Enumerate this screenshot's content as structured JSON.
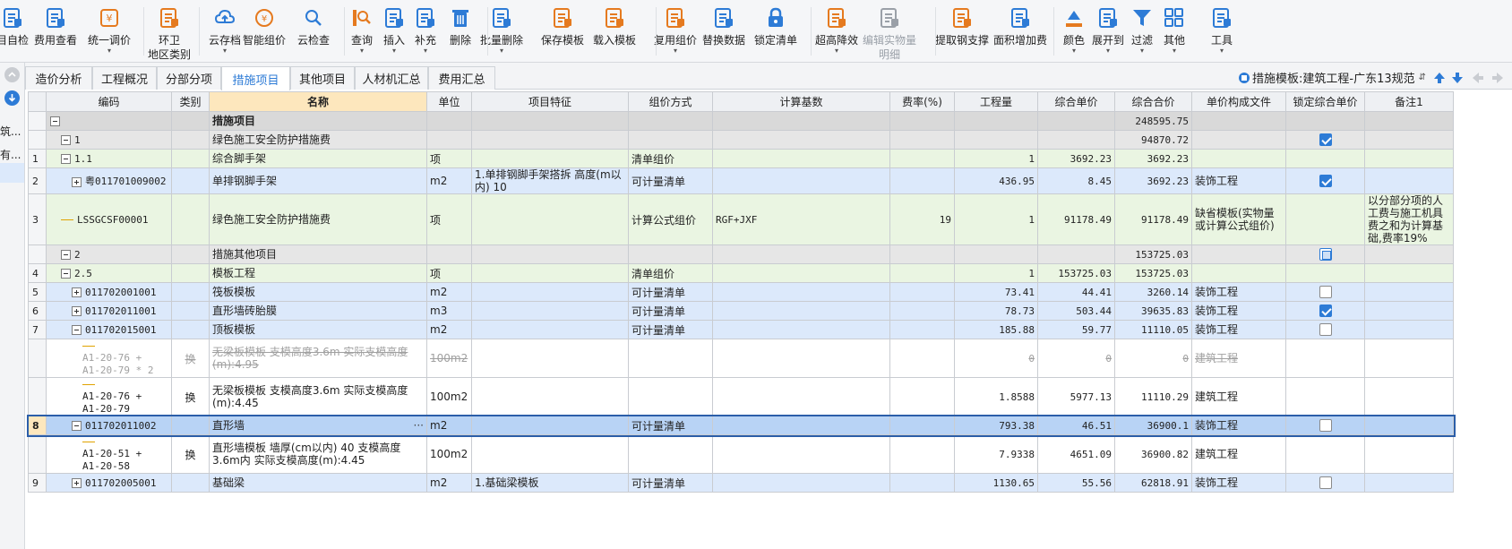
{
  "toolbar": {
    "items": [
      {
        "label": "目自检",
        "icon": "self-check-icon",
        "color": "#2d7bd6"
      },
      {
        "label": "费用查看",
        "icon": "fee-view-icon",
        "color": "#2d7bd6"
      },
      {
        "label": "统一调价",
        "icon": "price-adjust-icon",
        "color": "#e57a1f",
        "caret": true
      },
      {
        "label": "环卫",
        "label2": "地区类别",
        "icon": "region-category-icon",
        "color": "#e57a1f"
      },
      {
        "label": "云存档",
        "icon": "cloud-save-icon",
        "color": "#2d7bd6",
        "caret": true
      },
      {
        "label": "智能组价",
        "icon": "smart-pricing-icon",
        "color": "#e57a1f"
      },
      {
        "label": "云检查",
        "icon": "cloud-check-icon",
        "color": "#2d7bd6"
      },
      {
        "label": "查询",
        "icon": "query-icon",
        "color": "#e57a1f",
        "caret": true
      },
      {
        "label": "插入",
        "icon": "insert-icon",
        "color": "#2d7bd6",
        "caret": true
      },
      {
        "label": "补充",
        "icon": "supplement-icon",
        "color": "#2d7bd6",
        "caret": true
      },
      {
        "label": "删除",
        "icon": "delete-icon",
        "color": "#2d7bd6"
      },
      {
        "label": "批量删除",
        "icon": "batch-delete-icon",
        "color": "#2d7bd6",
        "caret": true
      },
      {
        "label": "保存模板",
        "icon": "save-template-icon",
        "color": "#e57a1f"
      },
      {
        "label": "载入模板",
        "icon": "load-template-icon",
        "color": "#e57a1f"
      },
      {
        "label": "复用组价",
        "icon": "reuse-pricing-icon",
        "color": "#e57a1f",
        "caret": true
      },
      {
        "label": "替换数据",
        "icon": "replace-data-icon",
        "color": "#2d7bd6"
      },
      {
        "label": "锁定清单",
        "icon": "lock-list-icon",
        "color": "#2d7bd6"
      },
      {
        "label": "超高降效",
        "icon": "super-height-icon",
        "color": "#e57a1f",
        "caret": true
      },
      {
        "label": "编辑实物量",
        "label2": "明细",
        "icon": "edit-quantity-icon",
        "color": "#9aa0a8",
        "disabled": true
      },
      {
        "label": "提取钢支撑",
        "icon": "extract-steel-icon",
        "color": "#e57a1f"
      },
      {
        "label": "面积增加费",
        "icon": "area-fee-icon",
        "color": "#2d7bd6"
      },
      {
        "label": "颜色",
        "icon": "color-icon",
        "color": "#2d7bd6",
        "caret": true
      },
      {
        "label": "展开到",
        "icon": "expand-to-icon",
        "color": "#2d7bd6",
        "caret": true
      },
      {
        "label": "过滤",
        "icon": "filter-icon",
        "color": "#2d7bd6",
        "caret": true
      },
      {
        "label": "其他",
        "icon": "other-icon",
        "color": "#2d7bd6",
        "caret": true
      },
      {
        "label": "工具",
        "icon": "tools-icon",
        "color": "#2d7bd6",
        "caret": true
      }
    ]
  },
  "leftstrip": {
    "item1": "筑...",
    "item2": "有..."
  },
  "tabs": [
    {
      "label": "造价分析",
      "active": false
    },
    {
      "label": "工程概况",
      "active": false
    },
    {
      "label": "分部分项",
      "active": false
    },
    {
      "label": "措施项目",
      "active": true
    },
    {
      "label": "其他项目",
      "active": false
    },
    {
      "label": "人材机汇总",
      "active": false
    },
    {
      "label": "费用汇总",
      "active": false
    }
  ],
  "template_info": "措施模板:建筑工程-广东13规范",
  "columns": [
    "编码",
    "类别",
    "名称",
    "单位",
    "项目特征",
    "组价方式",
    "计算基数",
    "费率(%)",
    "工程量",
    "综合单价",
    "综合合价",
    "单价构成文件",
    "锁定综合单价",
    "备注1"
  ],
  "rows": [
    {
      "no": "",
      "style": "bg-gray",
      "tree": "minus",
      "indent": 0,
      "code": "",
      "cat": "",
      "name": "措施项目",
      "unit": "",
      "feature": "",
      "method": "",
      "base": "",
      "rate": "",
      "qty": "",
      "price": "",
      "total": "248595.75",
      "file": "",
      "lock": "none",
      "note": "",
      "bold": true
    },
    {
      "no": "",
      "style": "bg-gray2",
      "tree": "minus",
      "indent": 1,
      "code": "1",
      "cat": "",
      "name": "绿色施工安全防护措施费",
      "unit": "",
      "feature": "",
      "method": "",
      "base": "",
      "rate": "",
      "qty": "",
      "price": "",
      "total": "94870.72",
      "file": "",
      "lock": "on",
      "note": ""
    },
    {
      "no": "1",
      "style": "bg-green",
      "tree": "minus",
      "indent": 1,
      "code": "1.1",
      "cat": "",
      "name": "综合脚手架",
      "unit": "项",
      "feature": "",
      "method": "清单组价",
      "base": "",
      "rate": "",
      "qty": "1",
      "price": "3692.23",
      "total": "3692.23",
      "file": "",
      "lock": "none",
      "note": ""
    },
    {
      "no": "2",
      "style": "bg-blue",
      "tree": "plus",
      "indent": 2,
      "code": "粤011701009002",
      "cat": "",
      "name": "单排钢脚手架",
      "unit": "m2",
      "feature": "1.单排钢脚手架搭拆 高度(m以内) 10",
      "method": "可计量清单",
      "base": "",
      "rate": "",
      "qty": "436.95",
      "price": "8.45",
      "total": "3692.23",
      "file": "装饰工程",
      "lock": "on",
      "note": ""
    },
    {
      "no": "3",
      "style": "bg-green",
      "tree": "line",
      "indent": 1,
      "code": "LSSGCSF00001",
      "cat": "",
      "name": "绿色施工安全防护措施费",
      "unit": "项",
      "feature": "",
      "method": "计算公式组价",
      "base": "RGF+JXF",
      "rate": "19",
      "qty": "1",
      "price": "91178.49",
      "total": "91178.49",
      "file": "缺省模板(实物量或计算公式组价)",
      "lock": "none",
      "note": "以分部分项的人工费与施工机具费之和为计算基础,费率19%",
      "tall": true
    },
    {
      "no": "",
      "style": "bg-gray2",
      "tree": "minus",
      "indent": 1,
      "code": "2",
      "cat": "",
      "name": "措施其他项目",
      "unit": "",
      "feature": "",
      "method": "",
      "base": "",
      "rate": "",
      "qty": "",
      "price": "",
      "total": "153725.03",
      "file": "",
      "lock": "mixed",
      "note": ""
    },
    {
      "no": "4",
      "style": "bg-green",
      "tree": "minus",
      "indent": 1,
      "code": "2.5",
      "cat": "",
      "name": "模板工程",
      "unit": "项",
      "feature": "",
      "method": "清单组价",
      "base": "",
      "rate": "",
      "qty": "1",
      "price": "153725.03",
      "total": "153725.03",
      "file": "",
      "lock": "none",
      "note": ""
    },
    {
      "no": "5",
      "style": "bg-blue",
      "tree": "plus",
      "indent": 2,
      "code": "011702001001",
      "cat": "",
      "name": "筏板模板",
      "unit": "m2",
      "feature": "",
      "method": "可计量清单",
      "base": "",
      "rate": "",
      "qty": "73.41",
      "price": "44.41",
      "total": "3260.14",
      "file": "装饰工程",
      "lock": "off",
      "note": ""
    },
    {
      "no": "6",
      "style": "bg-blue",
      "tree": "plus",
      "indent": 2,
      "code": "011702011001",
      "cat": "",
      "name": "直形墙砖胎膜",
      "unit": "m3",
      "feature": "",
      "method": "可计量清单",
      "base": "",
      "rate": "",
      "qty": "78.73",
      "price": "503.44",
      "total": "39635.83",
      "file": "装饰工程",
      "lock": "on",
      "note": ""
    },
    {
      "no": "7",
      "style": "bg-blue",
      "tree": "minus",
      "indent": 2,
      "code": "011702015001",
      "cat": "",
      "name": "顶板模板",
      "unit": "m2",
      "feature": "",
      "method": "可计量清单",
      "base": "",
      "rate": "",
      "qty": "185.88",
      "price": "59.77",
      "total": "11110.05",
      "file": "装饰工程",
      "lock": "off",
      "note": ""
    },
    {
      "no": "",
      "style": "bg-white strike",
      "tree": "sub",
      "indent": 3,
      "code": "A1-20-76 + A1-20-79 * 2",
      "cat": "换",
      "name": "无梁板模板 支模高度3.6m 实际支模高度(m):4.95",
      "unit": "100m2",
      "feature": "",
      "method": "",
      "base": "",
      "rate": "",
      "qty": "0",
      "price": "0",
      "total": "0",
      "file": "建筑工程",
      "lock": "none",
      "note": "",
      "tall": true
    },
    {
      "no": "",
      "style": "bg-white",
      "tree": "sub",
      "indent": 3,
      "code": "A1-20-76 + A1-20-79",
      "cat": "换",
      "name": "无梁板模板 支模高度3.6m 实际支模高度(m):4.45",
      "unit": "100m2",
      "feature": "",
      "method": "",
      "base": "",
      "rate": "",
      "qty": "1.8588",
      "price": "5977.13",
      "total": "11110.29",
      "file": "建筑工程",
      "lock": "none",
      "note": "",
      "tall": true
    },
    {
      "no": "8",
      "style": "bg-sel",
      "tree": "minus",
      "indent": 2,
      "code": "011702011002",
      "cat": "",
      "name": "直形墙",
      "unit": "m2",
      "feature": "",
      "method": "可计量清单",
      "base": "",
      "rate": "",
      "qty": "793.38",
      "price": "46.51",
      "total": "36900.1",
      "file": "装饰工程",
      "lock": "off",
      "note": "",
      "ellipsis": "···"
    },
    {
      "no": "",
      "style": "bg-white",
      "tree": "sub",
      "indent": 3,
      "code": "A1-20-51 + A1-20-58",
      "cat": "换",
      "name": "直形墙模板 墙厚(cm以内) 40 支模高度3.6m内 实际支模高度(m):4.45",
      "unit": "100m2",
      "feature": "",
      "method": "",
      "base": "",
      "rate": "",
      "qty": "7.9338",
      "price": "4651.09",
      "total": "36900.82",
      "file": "建筑工程",
      "lock": "none",
      "note": "",
      "tall": true
    },
    {
      "no": "9",
      "style": "bg-blue",
      "tree": "plus",
      "indent": 2,
      "code": "011702005001",
      "cat": "",
      "name": "基础梁",
      "unit": "m2",
      "feature": "1.基础梁模板",
      "method": "可计量清单",
      "base": "",
      "rate": "",
      "qty": "1130.65",
      "price": "55.56",
      "total": "62818.91",
      "file": "装饰工程",
      "lock": "off",
      "note": ""
    }
  ]
}
